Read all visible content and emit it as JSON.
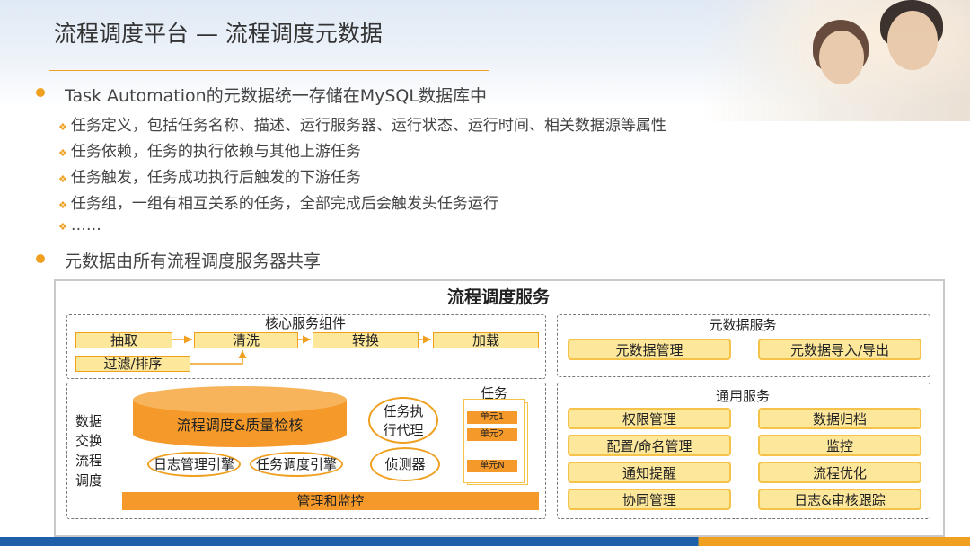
{
  "title": "流程调度平台 — 流程调度元数据",
  "bullets": [
    {
      "text": "Task Automation的元数据统一存储在MySQL数据库中",
      "subs": [
        "任务定义，包括任务名称、描述、运行服务器、运行状态、运行时间、相关数据源等属性",
        "任务依赖，任务的执行依赖与其他上游任务",
        "任务触发，任务成功执行后触发的下游任务",
        "任务组，一组有相互关系的任务，全部完成后会触发头任务运行",
        "……"
      ]
    },
    {
      "text": "元数据由所有流程调度服务器共享"
    }
  ],
  "diagram": {
    "title": "流程调度服务",
    "core": {
      "title": "核心服务组件",
      "steps": [
        "抽取",
        "清洗",
        "转换",
        "加载"
      ],
      "filter": "过滤/排序"
    },
    "metadata": {
      "title": "元数据服务",
      "items": [
        "元数据管理",
        "元数据导入/导出"
      ]
    },
    "exchange": {
      "label": "数据交换流程调度",
      "cylinder": "流程调度&质量检核",
      "log_engine": "日志管理引擎",
      "sched_engine": "任务调度引擎",
      "agent": "任务执行代理",
      "detector": "侦测器",
      "bar": "管理和监控",
      "task_title": "任务",
      "units": [
        "单元1",
        "单元2",
        "单元N"
      ]
    },
    "general": {
      "title": "通用服务",
      "items": [
        "权限管理",
        "数据归档",
        "配置/命名管理",
        "监控",
        "通知提醒",
        "流程优化",
        "协同管理",
        "日志&审核跟踪"
      ]
    }
  },
  "colors": {
    "accent": "#f0a020",
    "box_fill": "#fde79a",
    "bar": "#f59a2a",
    "footer_blue": "#1d5fa8"
  }
}
